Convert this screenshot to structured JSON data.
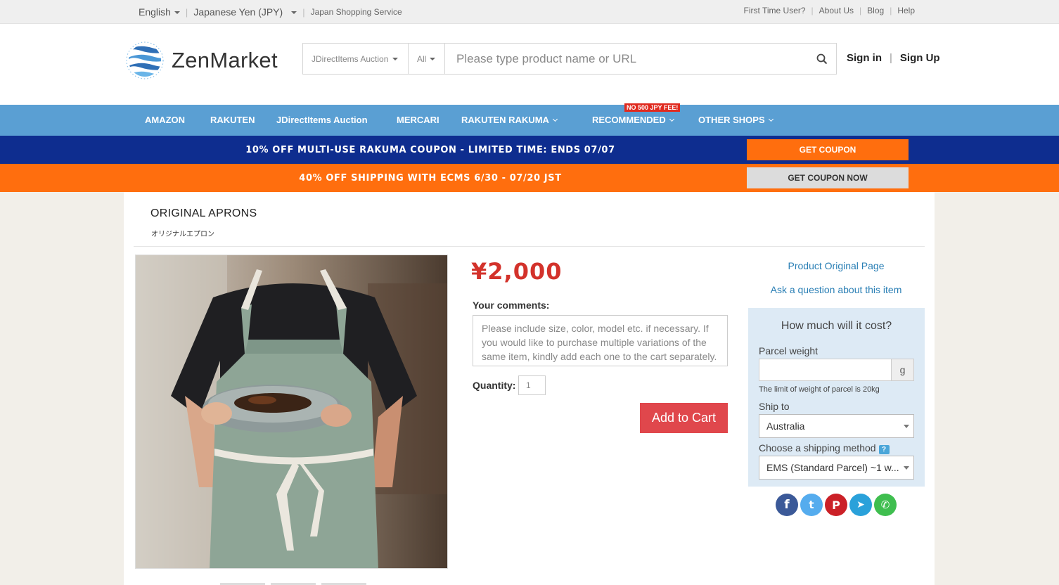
{
  "topbar": {
    "language": "English",
    "currency": "Japanese Yen (JPY)",
    "service": "Japan Shopping Service",
    "links": [
      "First Time User?",
      "About Us",
      "Blog",
      "Help"
    ]
  },
  "header": {
    "logo_text": "ZenMarket",
    "search": {
      "source": "JDirectItems Auction",
      "category": "All",
      "placeholder": "Please type product name or URL"
    },
    "sign_in": "Sign in",
    "sign_up": "Sign Up"
  },
  "nav": {
    "items": [
      "AMAZON",
      "RAKUTEN",
      "JDirectItems Auction",
      "MERCARI",
      "RAKUTEN RAKUMA",
      "RECOMMENDED",
      "OTHER SHOPS"
    ],
    "badge": "NO 500 JPY FEE!"
  },
  "banners": {
    "first": {
      "text": "10% OFF MULTI-USE RAKUMA COUPON - LIMITED TIME: ENDS 07/07",
      "button": "GET COUPON"
    },
    "second": {
      "text": "40% OFF SHIPPING WITH ECMS 6/30 - 07/20 JST",
      "button": "GET COUPON NOW"
    }
  },
  "product": {
    "title": "ORIGINAL APRONS",
    "subtitle": "オリジナルエプロン",
    "price": "¥2,000",
    "comments_label": "Your comments:",
    "comments_placeholder": "Please include size, color, model etc. if necessary. If you would like to purchase multiple variations of the same item, kindly add each one to the cart separately.",
    "quantity_label": "Quantity:",
    "quantity_value": "1",
    "add_to_cart": "Add to Cart"
  },
  "sidebar": {
    "original_page": "Product Original Page",
    "ask_question": "Ask a question about this item",
    "calc_title": "How much will it cost?",
    "weight_label": "Parcel weight",
    "weight_unit": "g",
    "weight_note": "The limit of weight of parcel is 20kg",
    "ship_to_label": "Ship to",
    "ship_to_value": "Australia",
    "method_label": "Choose a shipping method",
    "method_help": "?",
    "method_value": "EMS (Standard Parcel) ~1 w..."
  },
  "social": [
    {
      "name": "facebook",
      "color": "#3b5998",
      "glyph": "f"
    },
    {
      "name": "twitter",
      "color": "#55acee",
      "glyph": "t"
    },
    {
      "name": "pinterest",
      "color": "#cb2027",
      "glyph": "P"
    },
    {
      "name": "telegram",
      "color": "#2aa1da",
      "glyph": "➤"
    },
    {
      "name": "whatsapp",
      "color": "#3fbe4f",
      "glyph": "✆"
    }
  ]
}
